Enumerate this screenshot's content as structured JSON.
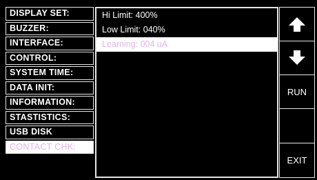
{
  "menu": {
    "items": [
      {
        "label": "DISPLAY SET:"
      },
      {
        "label": "BUZZER:"
      },
      {
        "label": "INTERFACE:"
      },
      {
        "label": "CONTROL:"
      },
      {
        "label": "SYSTEM TIME:"
      },
      {
        "label": "DATA INIT:"
      },
      {
        "label": "INFORMATION:"
      },
      {
        "label": "STASTISTICS:"
      },
      {
        "label": "USB DISK"
      },
      {
        "label": "CONTACT CHK:"
      }
    ]
  },
  "settings": {
    "rows": [
      {
        "text": "Hi Limit: 400%"
      },
      {
        "text": "Low Limit: 040%"
      },
      {
        "text": "Learning: 004 uA"
      }
    ]
  },
  "buttons": {
    "up_icon": "up-arrow-icon",
    "down_icon": "down-arrow-icon",
    "run_label": "RUN",
    "blank_label": "",
    "exit_label": "EXIT"
  },
  "colors": {
    "background": "#000000",
    "highlight_bg": "#ffffff",
    "highlight_text": "#e3b4e8"
  }
}
